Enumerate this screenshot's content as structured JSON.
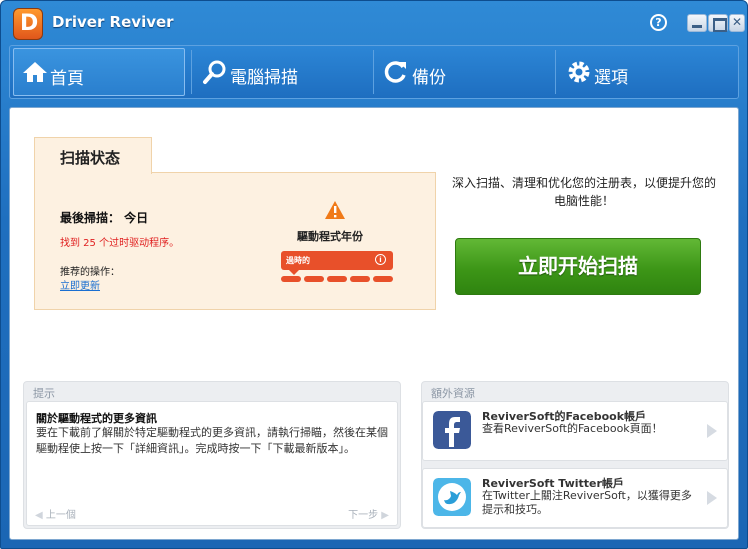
{
  "app": {
    "title": "Driver Reviver",
    "logo_letter": "D"
  },
  "titlebar": {
    "help_label": "?"
  },
  "nav": {
    "tabs": [
      {
        "label": "首頁",
        "icon": "home-icon",
        "active": true
      },
      {
        "label": "電腦掃描",
        "icon": "search-icon"
      },
      {
        "label": "備份",
        "icon": "refresh-icon"
      },
      {
        "label": "選項",
        "icon": "gear-icon"
      }
    ]
  },
  "scan_status": {
    "tab_label": "扫描状态",
    "last_scan": "最後掃描： 今日",
    "found": "找到 25 个过时驱动程序。",
    "recommended": "推荐的操作：",
    "update_link": "立即更新",
    "age_label": "驅動程式年份",
    "age_status": "過時的",
    "age_info": "i"
  },
  "scan": {
    "description": "深入扫描、清理和优化您的注册表，以便提升您的电脑性能！",
    "button": "立即开始扫描"
  },
  "tips": {
    "title": "提示",
    "heading": "關於驅動程式的更多資訊",
    "body": "要在下載前了解關於特定驅動程式的更多資訊，請執行掃瞄，然後在某個驅動程使上按一下「詳細資訊」。完成時按一下「下載最新版本」。",
    "prev": "上一個",
    "next": "下一步"
  },
  "resources": {
    "title": "額外資源",
    "items": [
      {
        "title": "ReviverSoft的Facebook帳戶",
        "desc": "查看ReviverSoft的Facebook頁面！",
        "icon": "facebook-icon"
      },
      {
        "title": "ReviverSoft Twitter帳戶",
        "desc": "在Twitter上關注ReviverSoft，以獲得更多提示和技巧。",
        "icon": "twitter-icon"
      }
    ]
  },
  "colors": {
    "accent": "#1f6fbf",
    "scan_button": "#3d9617",
    "warning": "#e8502a"
  }
}
